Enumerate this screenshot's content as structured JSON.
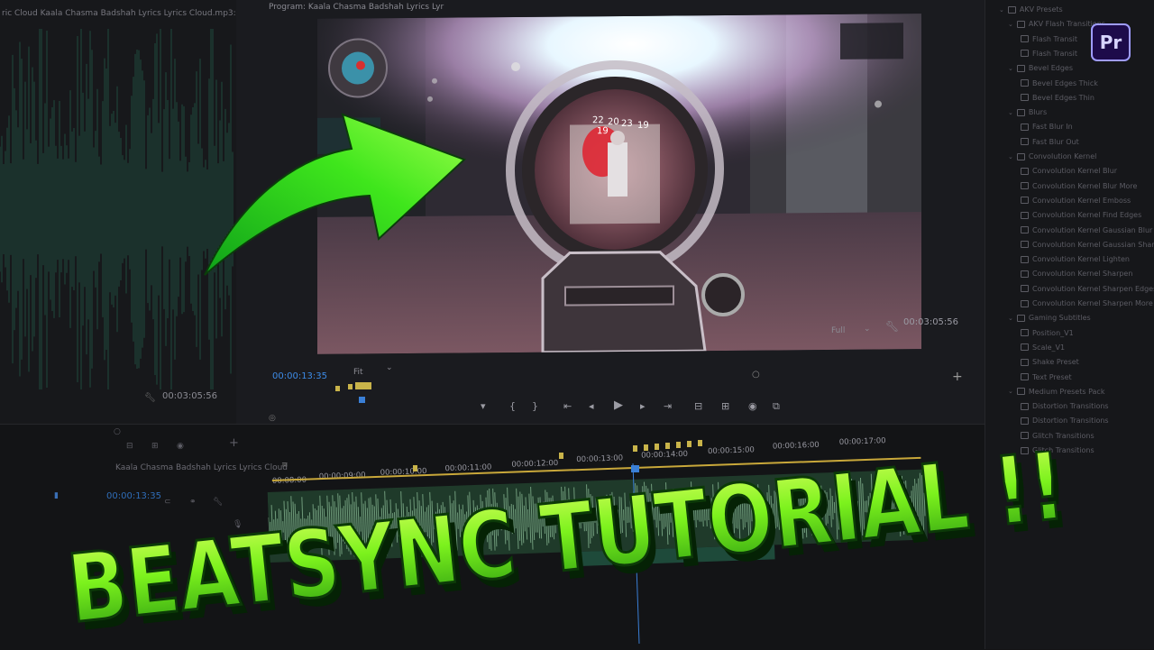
{
  "source": {
    "tab_label": "ric Cloud  Kaala Chasma  Badshah Lyrics  Lyrics Cloud.mp3: 0",
    "timecode": "00:03:05:56"
  },
  "program": {
    "tab_label": "Program: Kaala Chasma  Badshah Lyrics  Lyr",
    "timecode": "00:03:05:56",
    "resolution": "Full",
    "current_time": "00:00:13:35",
    "zoom": "Fit",
    "hud_numbers": [
      "22",
      "19",
      "20",
      "23",
      "19"
    ]
  },
  "effects_panel": {
    "items": [
      {
        "label": "AKV Presets",
        "level": 0
      },
      {
        "label": "AKV Flash Transitions",
        "level": 1
      },
      {
        "label": "Flash Transit",
        "level": 2
      },
      {
        "label": "Flash Transit",
        "level": 2
      },
      {
        "label": "Bevel Edges",
        "level": 1
      },
      {
        "label": "Bevel Edges Thick",
        "level": 2
      },
      {
        "label": "Bevel Edges Thin",
        "level": 2
      },
      {
        "label": "Blurs",
        "level": 1
      },
      {
        "label": "Fast Blur In",
        "level": 2
      },
      {
        "label": "Fast Blur Out",
        "level": 2
      },
      {
        "label": "Convolution Kernel",
        "level": 1
      },
      {
        "label": "Convolution Kernel Blur",
        "level": 2
      },
      {
        "label": "Convolution Kernel Blur More",
        "level": 2
      },
      {
        "label": "Convolution Kernel Emboss",
        "level": 2
      },
      {
        "label": "Convolution Kernel Find Edges",
        "level": 2
      },
      {
        "label": "Convolution Kernel Gaussian Blur",
        "level": 2
      },
      {
        "label": "Convolution Kernel Gaussian Sharpen",
        "level": 2
      },
      {
        "label": "Convolution Kernel Lighten",
        "level": 2
      },
      {
        "label": "Convolution Kernel Sharpen",
        "level": 2
      },
      {
        "label": "Convolution Kernel Sharpen Edges",
        "level": 2
      },
      {
        "label": "Convolution Kernel Sharpen More",
        "level": 2
      },
      {
        "label": "Gaming Subtitles",
        "level": 1
      },
      {
        "label": "Position_V1",
        "level": 2
      },
      {
        "label": "Scale_V1",
        "level": 2
      },
      {
        "label": "Shake Preset",
        "level": 2
      },
      {
        "label": "Text Preset",
        "level": 2
      },
      {
        "label": "Medium Presets Pack",
        "level": 1
      },
      {
        "label": "Distortion Transitions",
        "level": 2
      },
      {
        "label": "Distortion Transitions",
        "level": 2
      },
      {
        "label": "Glitch Transitions",
        "level": 2
      },
      {
        "label": "Glitch Transitions",
        "level": 2
      }
    ],
    "app_badge": "Pr"
  },
  "timeline": {
    "sequence_tab": "Kaala Chasma  Badshah Lyrics  Lyrics Cloud",
    "current_time": "00:00:13:35",
    "ruler": [
      "00:08:00",
      "00:00:09:00",
      "00:00:10:00",
      "00:00:11:00",
      "00:00:12:00",
      "00:00:13:00",
      "00:00:14:00",
      "00:00:15:00",
      "00:00:16:00",
      "00:00:17:00"
    ]
  },
  "overlay": {
    "title": "BEATSYNC TUTORIAL !!"
  },
  "colors": {
    "title_green": "#7cf21d",
    "arrow_green": "#49e81a",
    "accent_blue": "#3a7fd6",
    "pr_purple": "#9f9cff"
  }
}
